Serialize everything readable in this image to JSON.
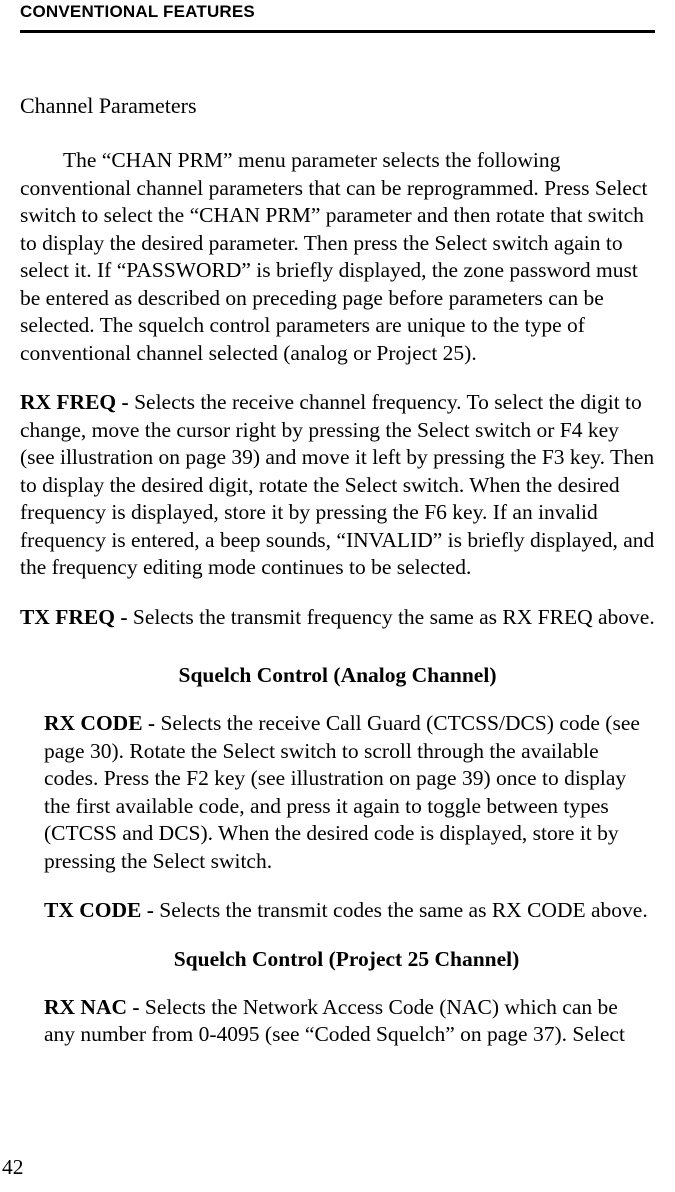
{
  "header": "CONVENTIONAL FEATURES",
  "sectionTitle": "Channel Parameters",
  "intro": "The “CHAN PRM” menu parameter selects the following conventional channel parameters that can be reprogrammed. Press Select switch to select the “CHAN PRM” parameter and then rotate that switch to display the desired parameter. Then press the Select switch again to select it. If “PASSWORD” is briefly displayed, the zone password must be entered as described on preceding page before parameters can be selected. The squelch control parameters are unique to the type of conventional channel selected (analog or Project 25).",
  "rxFreq": {
    "label": "RX FREQ - ",
    "text": "Selects the receive channel frequency. To select the digit to change, move the cursor right by pressing the Select switch or F4 key (see illustration on page 39) and move it left by pressing the F3 key. Then to display the desired digit, rotate the Select switch. When the desired frequency is displayed, store it by pressing the F6 key. If an invalid frequency is entered, a beep sounds, “INVALID” is briefly displayed, and the frequency editing mode continues to be selected."
  },
  "txFreq": {
    "label": "TX FREQ - ",
    "text": "Selects the transmit frequency the same as RX FREQ above."
  },
  "analogHeading": "Squelch Control (Analog Channel)",
  "rxCode": {
    "label": "RX CODE - ",
    "text": "Selects the receive Call Guard (CTCSS/DCS) code (see page 30). Rotate the Select switch to scroll through the available codes. Press the F2 key (see illustration on page 39) once to display the first available code, and press it again to toggle between types (CTCSS and DCS). When the desired code is displayed, store it by pressing the Select switch."
  },
  "txCode": {
    "label": "TX CODE - ",
    "text": "Selects the transmit codes the same as RX CODE above."
  },
  "p25Heading": "Squelch Control (Project 25 Channel)",
  "rxNac": {
    "label": "RX NAC - ",
    "text": "Selects the Network Access Code (NAC) which can be any number from 0-4095 (see “Coded Squelch” on page 37). Select"
  },
  "pageNumber": "42"
}
